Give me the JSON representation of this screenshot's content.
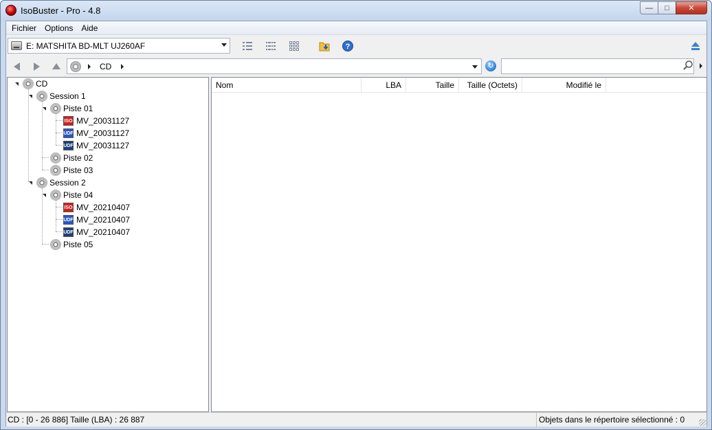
{
  "window": {
    "title": "IsoBuster - Pro - 4.8"
  },
  "menu": {
    "items": [
      "Fichier",
      "Options",
      "Aide"
    ]
  },
  "toolbar": {
    "drive": "E: MATSHITA  BD-MLT UJ260AF"
  },
  "address": {
    "crumb": "CD",
    "search_value": ""
  },
  "tree": {
    "root": "CD",
    "session1": "Session 1",
    "piste01": "Piste 01",
    "s1_file1": "MV_20031127",
    "s1_file2": "MV_20031127",
    "s1_file3": "MV_20031127",
    "piste02": "Piste 02",
    "piste03": "Piste 03",
    "session2": "Session 2",
    "piste04": "Piste 04",
    "s2_file1": "MV_20210407",
    "s2_file2": "MV_20210407",
    "s2_file3": "MV_20210407",
    "piste05": "Piste 05",
    "file_badges": [
      "ISO",
      "UDF",
      "UDF"
    ]
  },
  "list": {
    "columns": [
      "Nom",
      "LBA",
      "Taille",
      "Taille (Octets)",
      "Modifié le"
    ]
  },
  "status": {
    "left": "CD : [0 - 26 886]  Taille (LBA)  : 26 887",
    "right": "Objets dans le répertoire sélectionné : 0"
  },
  "colors": {
    "iso_badge": "#d21f1f",
    "udf_badge_blue": "#2a56c8",
    "udf_badge_dark": "#1d3f7a"
  }
}
